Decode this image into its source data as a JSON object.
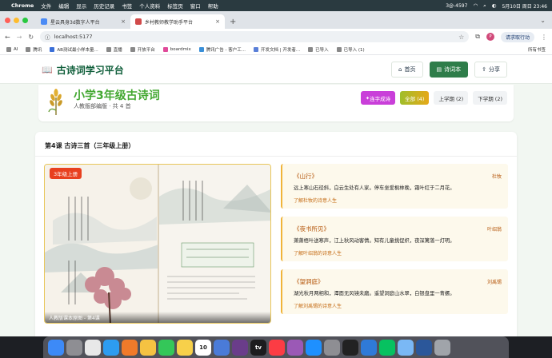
{
  "menubar": {
    "app": "Chrome",
    "items": [
      "文件",
      "编辑",
      "显示",
      "历史记录",
      "书签",
      "个人资料",
      "标签页",
      "窗口",
      "帮助"
    ],
    "status": "3@-4597",
    "datetime": "5月10日 周日 23:46"
  },
  "tabs": [
    {
      "label": "星云具身3d数字人平台",
      "color": "#4b8bf5"
    },
    {
      "label": "乡村教师教学助手平台",
      "color": "#d14a4a"
    }
  ],
  "toolbar": {
    "url": "localhost:5177",
    "avatar": "P",
    "resume": "请求取行动"
  },
  "bookmarks": {
    "items": [
      "AI",
      "腾讯",
      "AB测试最小样本量...",
      "直播",
      "开放平台",
      "boardmix",
      "腾讯广告 - 客户工...",
      "开发文档 | 开发者...",
      "已导入",
      "已导入 (1)"
    ],
    "right": "所有书签"
  },
  "site": {
    "title": "古诗词学习平台",
    "nav": {
      "home": "首页",
      "poems": "诗词本",
      "share": "分享"
    }
  },
  "grade": {
    "title": "小学3年级古诗词",
    "subtitle": "人教版部编版 · 共 4 首",
    "filters": {
      "lianzi": "连字成诗",
      "all": "全部 (4)",
      "first": "上学期 (2)",
      "second": "下学期 (2)"
    }
  },
  "lesson": {
    "title": "第4课 古诗三首（三年级上册）",
    "badge": "3年级上册",
    "caption": "人教版课本原图 - 第4课",
    "poems": [
      {
        "title": "《山行》",
        "author": "杜牧",
        "line": "远上寒山石径斜，白云生处有人家。停车坐爱枫林晚，霜叶红于二月花。",
        "link": "了解杜牧的诗意人生"
      },
      {
        "title": "《夜书所见》",
        "author": "叶绍翁",
        "line": "萧萧梧叶送寒声，江上秋风动客情。知有儿童挑促织，夜深篱落一灯明。",
        "link": "了解叶绍翁的诗意人生"
      },
      {
        "title": "《望洞庭》",
        "author": "刘禹锡",
        "line": "湖光秋月两相和，潭面无风镜未磨。遥望洞庭山水翠，白银盘里一青螺。",
        "link": "了解刘禹锡的诗意人生"
      }
    ]
  },
  "dock_apps": [
    "finder-icon",
    "launchpad-icon",
    "chrome-icon",
    "safari-icon",
    "firefox-icon",
    "photos-icon",
    "messages-icon",
    "notes-icon",
    "calendar-icon",
    "files-icon",
    "slack-icon",
    "tv-icon",
    "music-icon",
    "podcasts-icon",
    "appstore-icon",
    "settings-icon",
    "terminal-icon",
    "vscode-icon",
    "wechat-icon",
    "preview-icon",
    "word-icon",
    "trash-icon"
  ],
  "dock_calendar_day": "10",
  "dock_tv_label": "tv"
}
